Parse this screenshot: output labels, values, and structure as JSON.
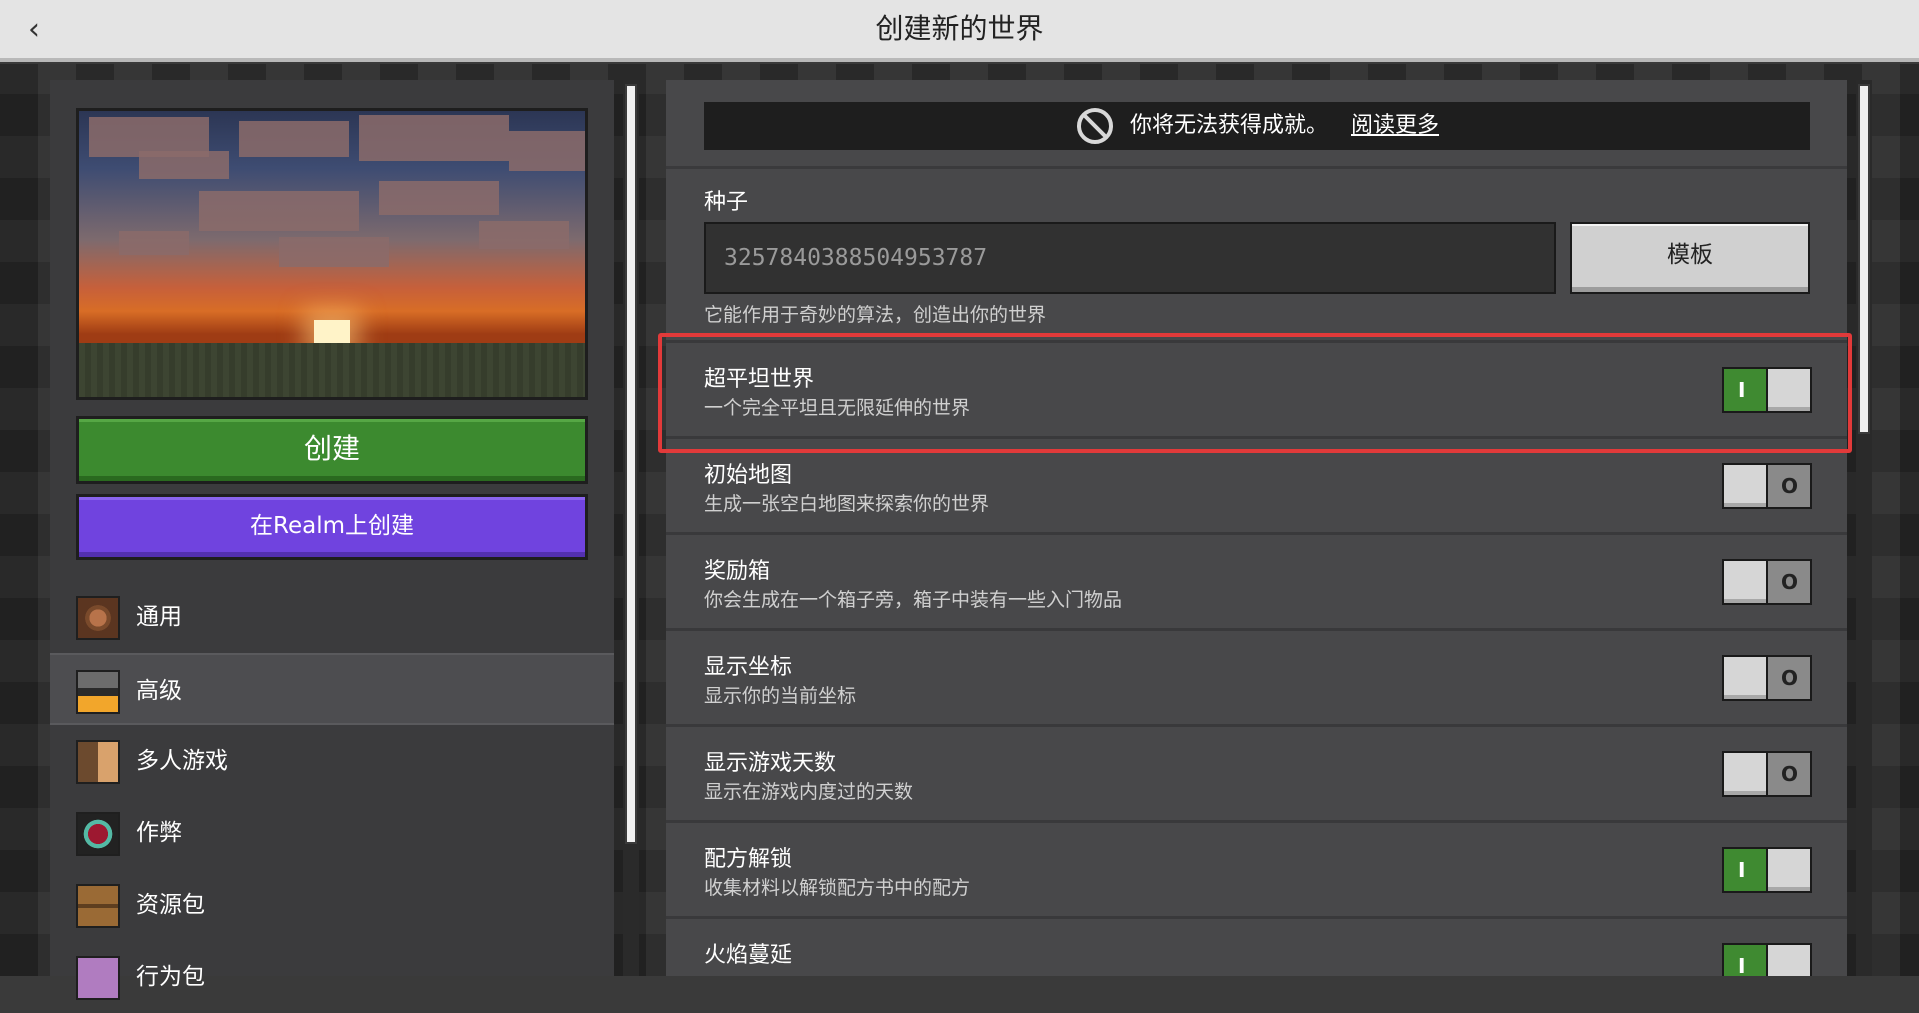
{
  "header": {
    "title": "创建新的世界",
    "back_icon": "chevron-left-icon"
  },
  "preview": {
    "description_icon": "world-preview-image"
  },
  "buttons": {
    "create": "创建",
    "create_realm": "在Realm上创建"
  },
  "nav": {
    "items": [
      {
        "label": "通用",
        "icon": "gear-icon",
        "active": false
      },
      {
        "label": "高级",
        "icon": "furnace-icon",
        "active": true
      },
      {
        "label": "多人游戏",
        "icon": "players-icon",
        "active": false
      },
      {
        "label": "作弊",
        "icon": "cheat-icon",
        "active": false
      },
      {
        "label": "资源包",
        "icon": "chest-icon",
        "active": false
      },
      {
        "label": "行为包",
        "icon": "behavior-icon",
        "active": false
      }
    ]
  },
  "achievement": {
    "text": "你将无法获得成就。",
    "link": "阅读更多",
    "icon": "no-achievement-icon"
  },
  "seed": {
    "label": "种子",
    "value": "3257840388504953787",
    "template_button": "模板",
    "hint": "它能作用于奇妙的算法，创造出你的世界"
  },
  "settings": [
    {
      "title": "超平坦世界",
      "desc": "一个完全平坦且无限延伸的世界",
      "on": true
    },
    {
      "title": "初始地图",
      "desc": "生成一张空白地图来探索你的世界",
      "on": false
    },
    {
      "title": "奖励箱",
      "desc": "你会生成在一个箱子旁，箱子中装有一些入门物品",
      "on": false
    },
    {
      "title": "显示坐标",
      "desc": "显示你的当前坐标",
      "on": false
    },
    {
      "title": "显示游戏天数",
      "desc": "显示在游戏内度过的天数",
      "on": false
    },
    {
      "title": "配方解锁",
      "desc": "收集材料以解锁配方书中的配方",
      "on": true
    },
    {
      "title": "火焰蔓延",
      "desc": "",
      "on": true
    }
  ],
  "toggle_marks": {
    "on": "I",
    "off": "O"
  },
  "colors": {
    "create_green": "#3c8a2f",
    "realm_purple": "#7043df",
    "toggle_on": "#3f8a31",
    "highlight_red": "#e23a3a"
  }
}
